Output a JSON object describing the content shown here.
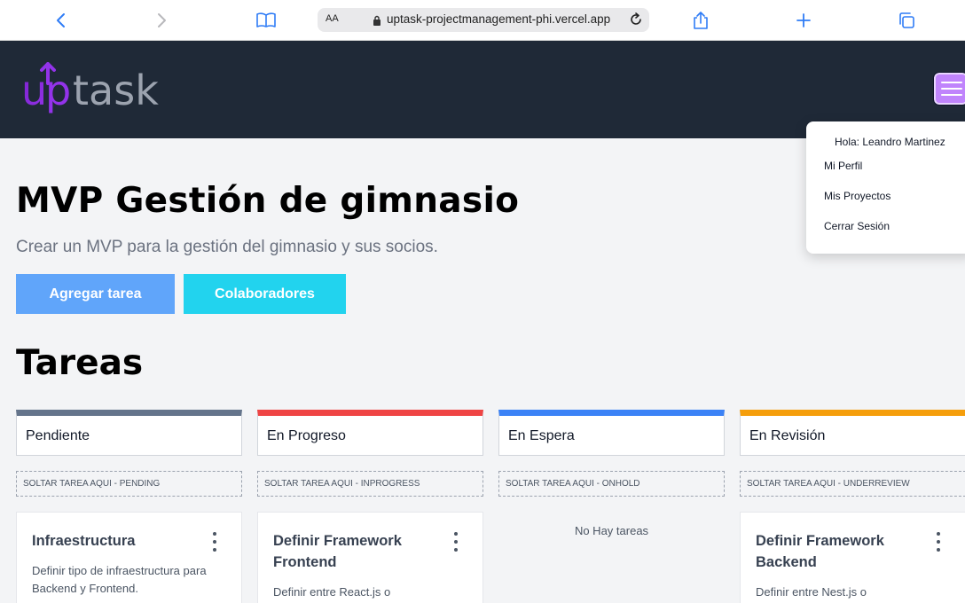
{
  "browser": {
    "text_size_label": "AA",
    "url": "uptask-projectmanagement-phi.vercel.app"
  },
  "header": {
    "logo_text": "uptask",
    "colors": {
      "background": "#1f2937",
      "menu_button": "#c084fc",
      "logo_accent": "#9333ea",
      "logo_text": "#9ca3af"
    }
  },
  "user_menu": {
    "greeting": "Hola: Leandro Martinez",
    "items": [
      "Mi Perfil",
      "Mis Proyectos",
      "Cerrar Sesión"
    ]
  },
  "project": {
    "name": "MVP Gestión de gimnasio",
    "description": "Crear un MVP para la gestión del gimnasio y sus socios.",
    "add_task_label": "Agregar tarea",
    "collaborators_label": "Colaboradores"
  },
  "tasks_heading": "Tareas",
  "columns": [
    {
      "label": "Pendiente",
      "color": "#64748b",
      "drop_label": "SOLTAR TAREA AQUI - PENDING",
      "card": {
        "title": "Infraestructura",
        "description": "Definir tipo de infraestructura para Backend y Frontend."
      }
    },
    {
      "label": "En Progreso",
      "color": "#ef4444",
      "drop_label": "SOLTAR TAREA AQUI - INPROGRESS",
      "card": {
        "title": "Definir Framework Frontend",
        "description": "Definir entre React.js o"
      }
    },
    {
      "label": "En Espera",
      "color": "#3b82f6",
      "drop_label": "SOLTAR TAREA AQUI - ONHOLD",
      "empty_label": "No Hay tareas"
    },
    {
      "label": "En Revisión",
      "color": "#f59e0b",
      "drop_label": "SOLTAR TAREA AQUI - UNDERREVIEW",
      "card": {
        "title": "Definir Framework Backend",
        "description": "Definir entre Nest.js o"
      }
    }
  ]
}
